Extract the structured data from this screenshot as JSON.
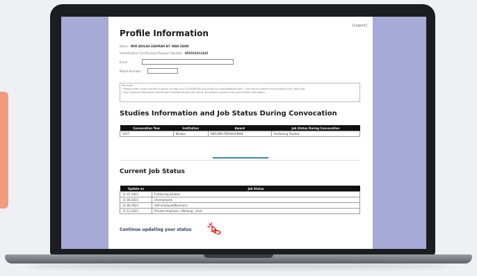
{
  "page": {
    "logout": "[Logout]",
    "title": "Profile Information",
    "name_label": "Name :",
    "name_value": "NUR ADILAH ZAHIRAH BT. WAN ZAINI",
    "ic_label": "Identification Card Number/Passport Number :",
    "ic_value": "950101012345",
    "email_label": "Email :",
    "email_value": "",
    "mobile_label": "Mobile Number :",
    "mobile_value": "",
    "note_title": "Reminder",
    "note_line1": "* Please enter a valid format of phone number (e.g 0123456789) and email (e.g name@gmail.com). Click the link below and proceed to the next step.",
    "note_line2": "* Your personal information will be kept confidential and will not be disclosed to anyone with your limited information.",
    "studies_title": "Studies Information and Job Status During Convocation",
    "studies_headers": [
      "Convocation Year",
      "Institution",
      "Award",
      "Job Status During Convocation"
    ],
    "studies_rows": [
      [
        "2017",
        "Melaka",
        "DIPLOMA PERAKAUNAN",
        "Furthering Studies"
      ]
    ],
    "current_title": "Current Job Status",
    "current_headers": [
      "Update on",
      "Job Status"
    ],
    "current_rows": [
      [
        "11-07-2021",
        "Furthering Studies"
      ],
      [
        "11-06-2021",
        "Unemployed"
      ],
      [
        "11-06-2021",
        "Self-employed/Business"
      ],
      [
        "11-12-2021",
        "Private employee / Working - Govt"
      ]
    ],
    "continue_text": "Continue updating your status"
  },
  "colors": {
    "accent_card": "#f39a7e",
    "screen_bg": "#a7aad6",
    "link": "#2a3a6e",
    "cursor": "#e2231a"
  },
  "icons": {
    "cursor": "hand-pointer-click-icon"
  }
}
